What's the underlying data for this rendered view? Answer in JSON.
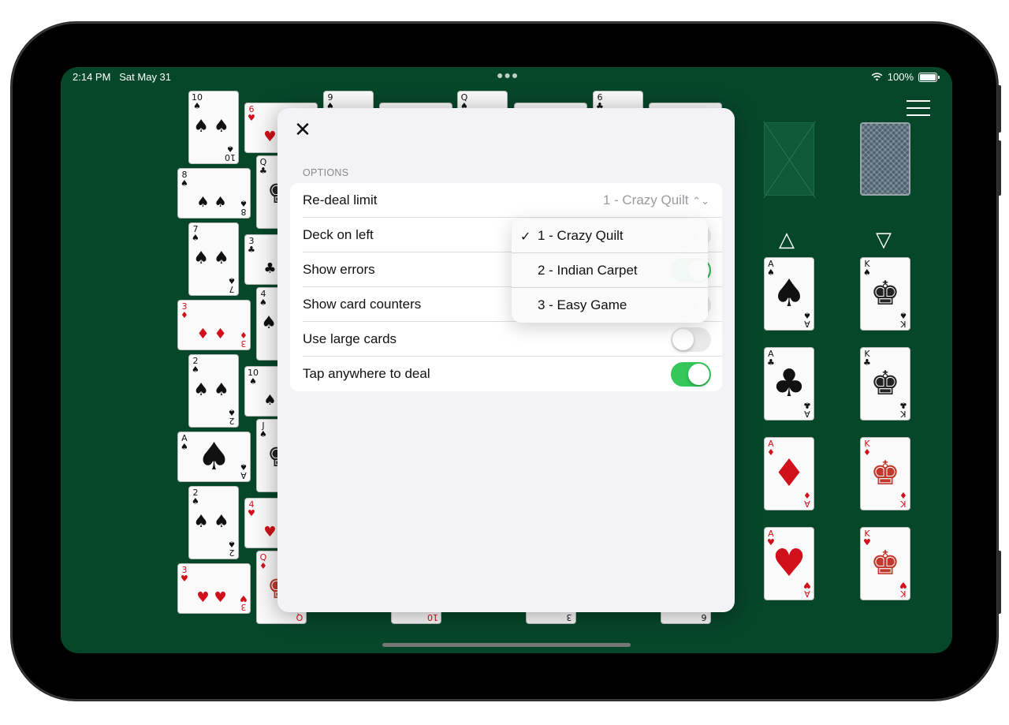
{
  "status_bar": {
    "time": "2:14 PM",
    "date": "Sat May 31",
    "battery": "100%"
  },
  "options_sheet": {
    "section_title": "OPTIONS",
    "rows": [
      {
        "label": "Re-deal limit",
        "value": "1 - Crazy Quilt"
      },
      {
        "label": "Deck on left"
      },
      {
        "label": "Show errors"
      },
      {
        "label": "Show card counters"
      },
      {
        "label": "Use large cards",
        "toggle": false
      },
      {
        "label": "Tap anywhere to deal",
        "toggle": true
      }
    ],
    "redeal_menu": {
      "options": [
        "1 - Crazy Quilt",
        "2 - Indian Carpet",
        "3 - Easy Game"
      ],
      "selected": "1 - Crazy Quilt"
    }
  },
  "foundations": {
    "aces": [
      {
        "rank": "A",
        "suit": "♠"
      },
      {
        "rank": "A",
        "suit": "♣"
      },
      {
        "rank": "A",
        "suit": "♦"
      },
      {
        "rank": "A",
        "suit": "♥"
      }
    ],
    "kings": [
      {
        "rank": "K",
        "suit": "♠"
      },
      {
        "rank": "K",
        "suit": "♣"
      },
      {
        "rank": "K",
        "suit": "♦"
      },
      {
        "rank": "K",
        "suit": "♥"
      }
    ],
    "up_arrow": "△",
    "down_arrow": "▽"
  },
  "tableau": {
    "col1": [
      {
        "rank": "10",
        "suit": "♠"
      },
      {
        "rank": "8",
        "suit": "♠"
      },
      {
        "rank": "7",
        "suit": "♠"
      },
      {
        "rank": "3",
        "suit": "♦"
      },
      {
        "rank": "2",
        "suit": "♠"
      },
      {
        "rank": "A",
        "suit": "♠"
      },
      {
        "rank": "2",
        "suit": "♠"
      },
      {
        "rank": "3",
        "suit": "♥"
      }
    ],
    "col2": [
      {
        "rank": "6",
        "suit": "♥"
      },
      {
        "rank": "Q",
        "suit": "♣"
      },
      {
        "rank": "3",
        "suit": "♣"
      },
      {
        "rank": "4",
        "suit": "♠"
      },
      {
        "rank": "10",
        "suit": "♠"
      },
      {
        "rank": "J",
        "suit": "♠"
      },
      {
        "rank": "4",
        "suit": "♥"
      },
      {
        "rank": "Q",
        "suit": "♦"
      }
    ],
    "top_peek": [
      {
        "rank": "9",
        "suit": "♠"
      },
      {
        "rank": "Q",
        "suit": "♠"
      },
      {
        "rank": "6",
        "suit": "♣"
      }
    ],
    "bottom_peek": [
      {
        "rank": "10",
        "suit": "♦"
      },
      {
        "rank": "3",
        "suit": "♣"
      },
      {
        "rank": "6",
        "suit": "♣"
      }
    ]
  },
  "colors": {
    "table": "#06472a",
    "toggle_on": "#34c759",
    "red_suit": "#d0101a"
  }
}
